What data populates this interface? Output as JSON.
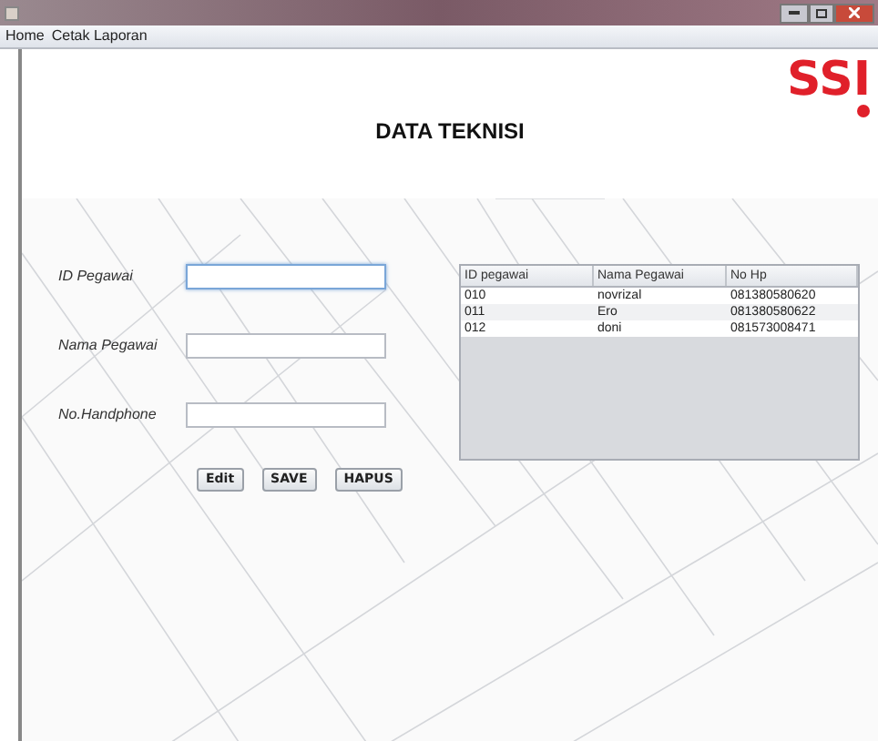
{
  "menu": [
    "Home",
    "Cetak Laporan"
  ],
  "header": {
    "title": "DATA TEKNISI",
    "logo": "SSI"
  },
  "form": {
    "fields": [
      {
        "label": "ID Pegawai",
        "focused": true
      },
      {
        "label": "Nama Pegawai",
        "focused": false
      },
      {
        "label": "No.Handphone",
        "focused": false
      }
    ],
    "buttons": [
      "Edit",
      "SAVE",
      "HAPUS"
    ]
  },
  "table": {
    "columns": [
      "ID pegawai",
      "Nama Pegawai",
      "No Hp"
    ],
    "rows": [
      [
        "010",
        "novrizal",
        "081380580620"
      ],
      [
        "011",
        "Ero",
        "081380580622"
      ],
      [
        "012",
        "doni",
        "081573008471"
      ]
    ]
  }
}
